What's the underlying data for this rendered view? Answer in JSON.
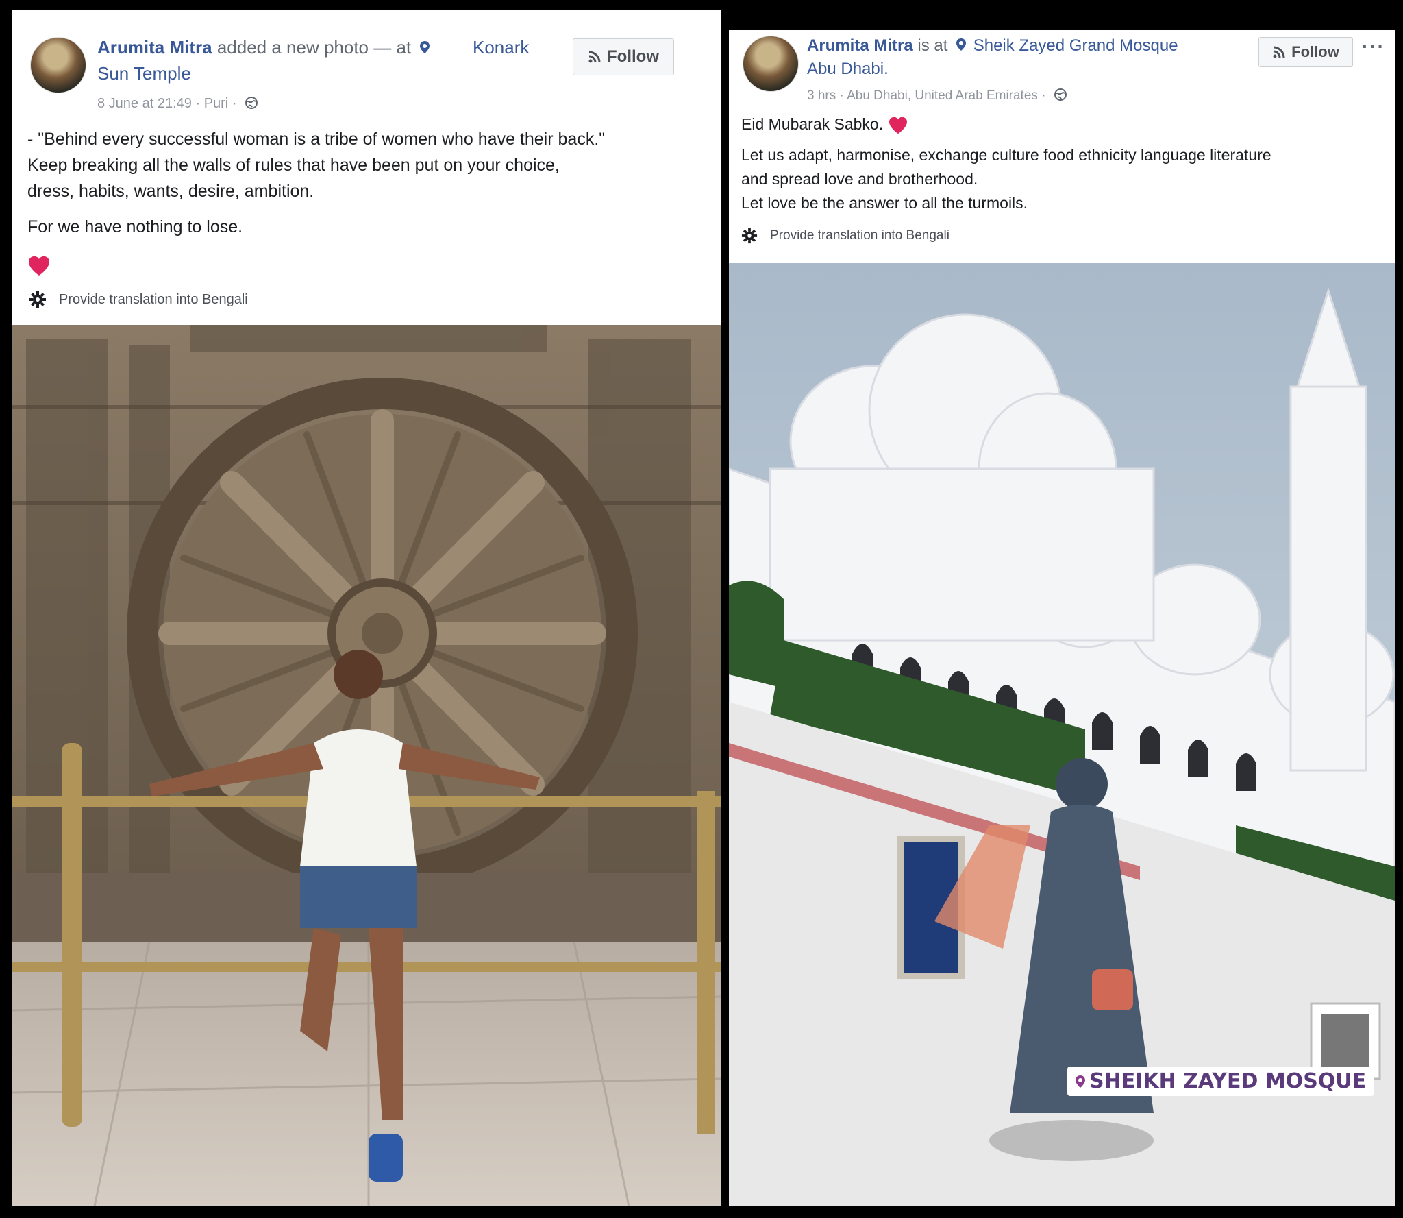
{
  "left_post": {
    "author": "Arumita Mitra",
    "action": "added a new photo — at",
    "place": "Konark Sun Temple",
    "timestamp": "8 June at 21:49",
    "separator": "·",
    "location": "Puri",
    "follow_label": "Follow",
    "text": {
      "line1": "- \"Behind every successful woman is a tribe of women who have their back.\"",
      "line2": "Keep breaking all the walls of rules that have been put on your choice,",
      "line3": "dress, habits, wants, desire, ambition.",
      "line4": "For we have nothing to lose."
    },
    "translate_label": "Provide translation into Bengali",
    "icons": {
      "location": "location-pin-icon",
      "privacy": "globe-icon",
      "follow": "rss-icon",
      "reaction": "heart-icon",
      "settings": "gear-icon"
    }
  },
  "right_post": {
    "author": "Arumita Mitra",
    "action": "is at",
    "place": "Sheik Zayed Grand Mosque Abu Dhabi.",
    "place_line1": "Sheik Zayed Grand Mosque",
    "place_line2": "Abu Dhabi.",
    "timestamp": "3 hrs",
    "separator": "·",
    "location": "Abu Dhabi, United Arab Emirates",
    "follow_label": "Follow",
    "more_label": "···",
    "text": {
      "line1": "Eid Mubarak Sabko.",
      "line2": "Let us adapt, harmonise, exchange culture food ethnicity language literature",
      "line3": "and spread love and brotherhood.",
      "line4": "Let love be the answer to all the turmoils."
    },
    "translate_label": "Provide translation into Bengali",
    "photo_sticker": "SHEIKH ZAYED MOSQUE"
  },
  "colors": {
    "link": "#385898",
    "meta": "#90949c",
    "heart": "#e0245e",
    "background": "#000000"
  }
}
